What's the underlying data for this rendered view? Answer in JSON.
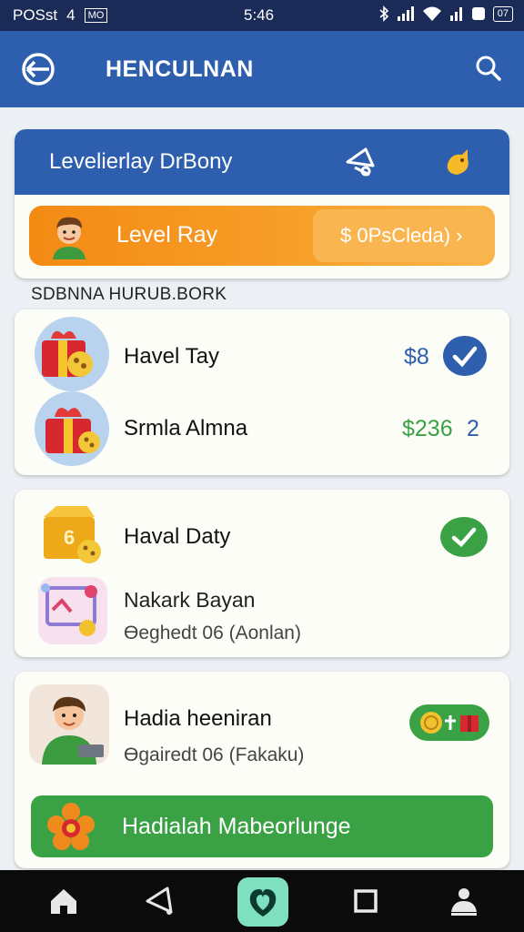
{
  "status_bar": {
    "carrier": "POSst",
    "carrier_suffix": "4",
    "badge": "MO",
    "time": "5:46",
    "battery": "07"
  },
  "app_bar": {
    "title": "HENCULNAN",
    "icons": [
      "back-icon",
      "search-icon"
    ]
  },
  "hero": {
    "title": "Levelierlay DrBony",
    "icons": [
      "share-bell-icon",
      "bird-icon"
    ],
    "level_bar": {
      "label": "Level Ray",
      "pill_text": "$ 0PsCleda) ›"
    }
  },
  "section": {
    "label": "SDBNNA HURUB.BORK"
  },
  "list_one": [
    {
      "title": "Havel Tay",
      "amount": "$8",
      "amount_color": "#2e5fae",
      "icon": "gift-icon"
    },
    {
      "title": "Srmla Almna",
      "amount": "$236",
      "count": "2",
      "amount_color": "#3aa244",
      "icon": "gift-icon"
    }
  ],
  "list_two": {
    "title": "Haval Daty",
    "item_title": "Nakark Bayan",
    "item_sub": "Ɵeghedt 06 (Aonlan)",
    "icons": [
      "gold-box-icon",
      "photo-frame-icon"
    ]
  },
  "list_three": {
    "title": "Hadia heeniran",
    "sub": "Ɵgairedt 06 (Fakaku)",
    "button_label": "Hadialah Mabeorlunge",
    "icons": [
      "person-avatar-icon",
      "coin-gift-icon",
      "flower-icon"
    ]
  },
  "colors": {
    "primary": "#2e5fae",
    "orange": "#f38a14",
    "green": "#3aa244",
    "nav_active": "#7fe0c0"
  },
  "nav": [
    "home-icon",
    "share-icon",
    "heart-shield-icon",
    "square-icon",
    "profile-icon"
  ]
}
